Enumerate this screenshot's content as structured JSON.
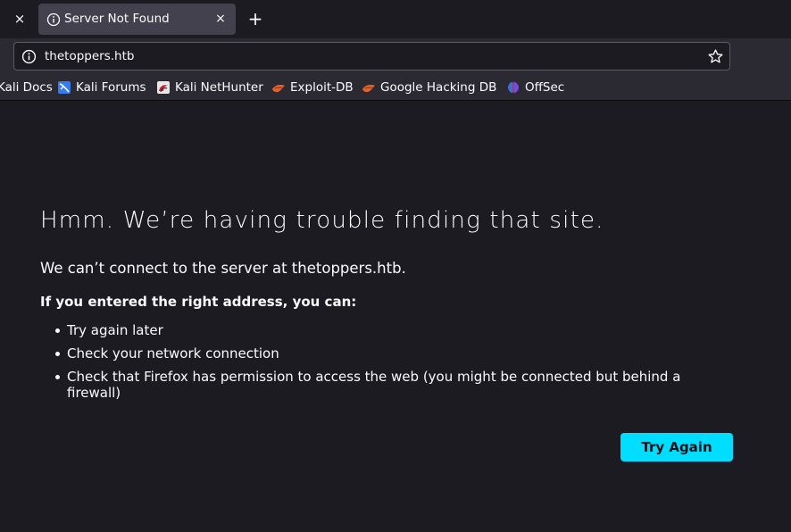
{
  "tabs": {
    "active_title": "Server Not Found",
    "close_symbol": "×",
    "new_tab_symbol": "+"
  },
  "navbar": {
    "url": "thetoppers.htb"
  },
  "bookmarks": [
    {
      "label": "Kali Docs",
      "icon": "kali-docs-icon"
    },
    {
      "label": "Kali Forums",
      "icon": "kali-forums-icon"
    },
    {
      "label": "Kali NetHunter",
      "icon": "kali-nethunter-icon"
    },
    {
      "label": "Exploit-DB",
      "icon": "exploit-db-icon"
    },
    {
      "label": "Google Hacking DB",
      "icon": "exploit-db-icon"
    },
    {
      "label": "OffSec",
      "icon": "offsec-icon"
    }
  ],
  "error_page": {
    "title": "Hmm. We’re having trouble finding that site.",
    "description": "We can’t connect to the server at thetoppers.htb.",
    "subheading": "If you entered the right address, you can:",
    "suggestions": [
      "Try again later",
      "Check your network connection",
      "Check that Firefox has permission to access the web (you might be connected but behind a firewall)"
    ],
    "try_again_label": "Try Again"
  },
  "colors": {
    "background": "#1c1b22",
    "toolbar": "#2b2a33",
    "tab_active": "#42414d",
    "accent_button": "#00ddff"
  }
}
